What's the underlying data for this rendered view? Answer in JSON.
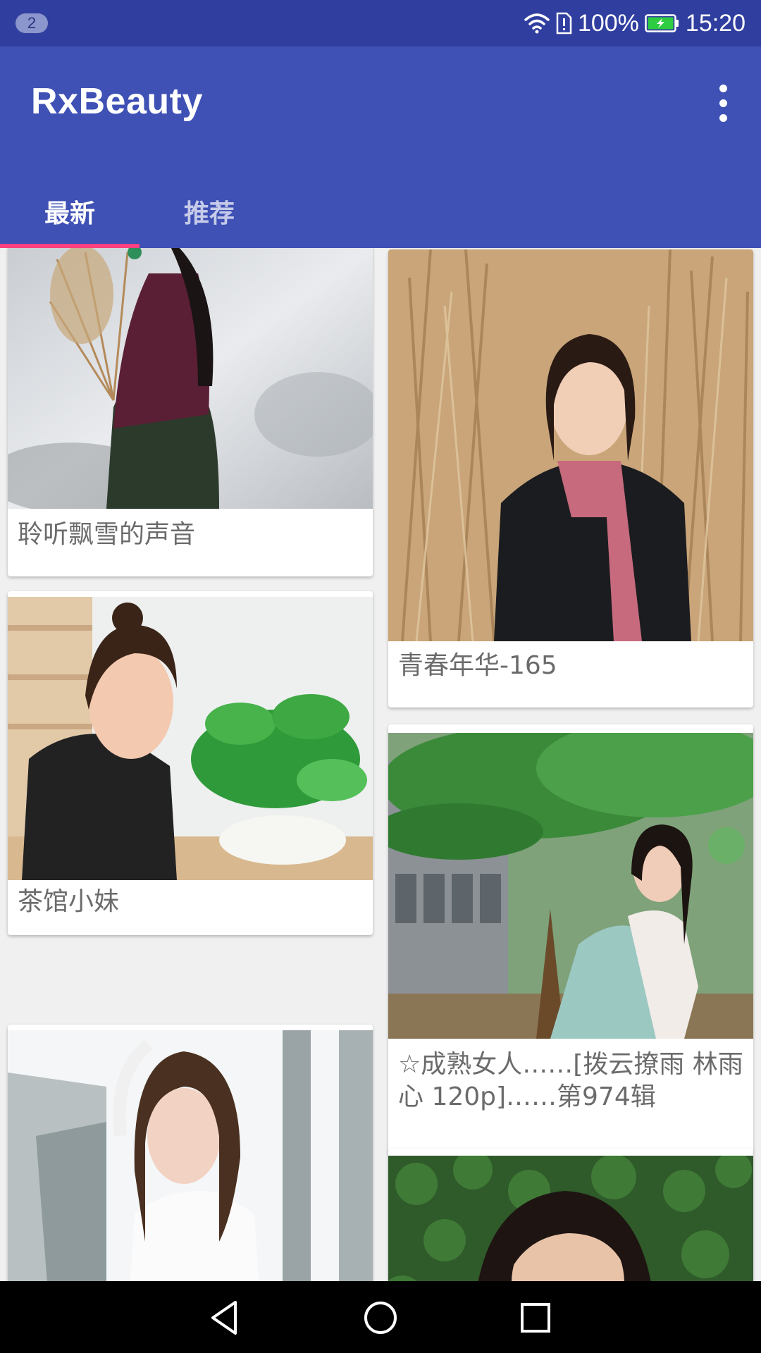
{
  "status_bar": {
    "notification_count": "2",
    "battery_percent": "100%",
    "time": "15:20",
    "icons": [
      "wifi-icon",
      "sim-icon",
      "battery-charging-icon"
    ]
  },
  "app_bar": {
    "title": "RxBeauty",
    "menu_icon": "more-vert-icon",
    "background_color": "#3f51b5",
    "indicator_color": "#ff4081"
  },
  "tabs": [
    {
      "label": "最新",
      "selected": true
    },
    {
      "label": "推荐",
      "selected": false
    }
  ],
  "feed": {
    "left_column": [
      {
        "caption": "聆听飘雪的声音"
      },
      {
        "caption": "茶馆小妹"
      },
      {
        "caption": ""
      }
    ],
    "right_column": [
      {
        "caption": "青春年华-165"
      },
      {
        "caption": "☆成熟女人……[拨云撩雨 林雨心 120p]……第974辑"
      },
      {
        "caption": ""
      }
    ]
  },
  "nav_bar": {
    "buttons": [
      "back-icon",
      "home-icon",
      "recents-icon"
    ]
  }
}
